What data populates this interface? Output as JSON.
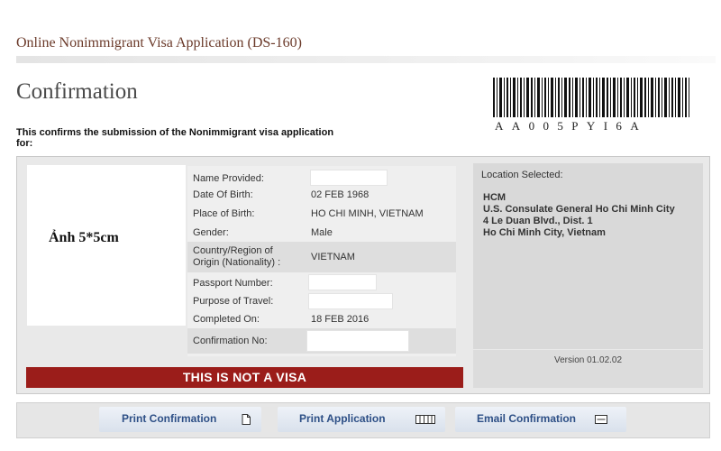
{
  "header": {
    "app_title": "Online Nonimmigrant Visa Application (DS-160)",
    "page_title": "Confirmation",
    "intro_text": "This confirms the submission of the Nonimmigrant visa application for:"
  },
  "barcode": {
    "text": "AA005PYI6A"
  },
  "photo": {
    "label": "Ảnh 5*5cm"
  },
  "applicant": {
    "name_label": "Name Provided:",
    "name_value": "",
    "dob_label": "Date Of Birth:",
    "dob_value": "02 FEB 1968",
    "pob_label": "Place of Birth:",
    "pob_value": "HO CHI MINH, VIETNAM",
    "gender_label": "Gender:",
    "gender_value": "Male",
    "country_label_1": "Country/Region of",
    "country_label_2": "Origin (Nationality) :",
    "country_value": "VIETNAM",
    "passport_label": "Passport Number:",
    "passport_value": "",
    "purpose_label": "Purpose of Travel:",
    "purpose_value": "",
    "completed_label": "Completed On:",
    "completed_value": "18 FEB 2016",
    "confirmation_label": "Confirmation No:",
    "confirmation_value": ""
  },
  "warning": {
    "text": "THIS IS NOT A VISA",
    "color": "#9b1d1a"
  },
  "location": {
    "label": "Location Selected:",
    "code": "HCM",
    "line1": "U.S. Consulate General Ho Chi Minh City",
    "line2": "4 Le Duan Blvd., Dist. 1",
    "line3": "Ho Chi Minh City, Vietnam"
  },
  "version": {
    "text": "Version 01.02.02"
  },
  "actions": {
    "print_confirmation": "Print Confirmation",
    "print_application": "Print Application",
    "email_confirmation": "Email Confirmation",
    "print_confirmation_icon": "document-icon",
    "print_application_icon": "multi-page-icon",
    "email_confirmation_icon": "envelope-icon"
  }
}
